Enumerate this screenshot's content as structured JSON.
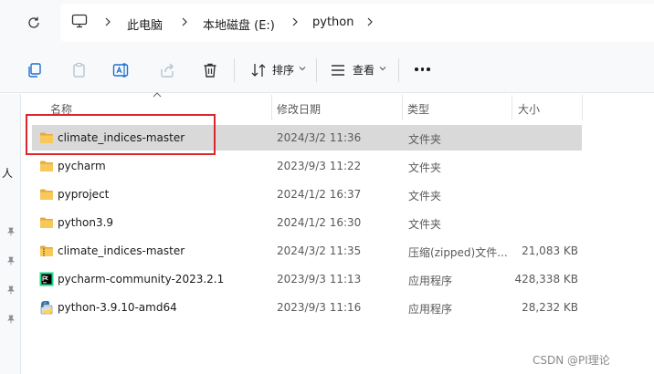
{
  "address_bar": {
    "crumbs": [
      "此电脑",
      "本地磁盘 (E:)",
      "python"
    ]
  },
  "command_bar": {
    "sort_label": "排序",
    "view_label": "查看"
  },
  "nav_pane": {
    "text": "人"
  },
  "columns": {
    "name": "名称",
    "modified": "修改日期",
    "type": "类型",
    "size": "大小"
  },
  "files": [
    {
      "name": "climate_indices-master",
      "modified": "2024/3/2 11:36",
      "type": "文件夹",
      "size": "",
      "icon": "folder-icon",
      "selected": true
    },
    {
      "name": "pycharm",
      "modified": "2023/9/3 11:22",
      "type": "文件夹",
      "size": "",
      "icon": "folder-icon",
      "selected": false
    },
    {
      "name": "pyproject",
      "modified": "2024/1/2 16:37",
      "type": "文件夹",
      "size": "",
      "icon": "folder-icon",
      "selected": false
    },
    {
      "name": "python3.9",
      "modified": "2024/1/2 16:30",
      "type": "文件夹",
      "size": "",
      "icon": "folder-icon",
      "selected": false
    },
    {
      "name": "climate_indices-master",
      "modified": "2024/3/2 11:35",
      "type": "压缩(zipped)文件...",
      "size": "21,083 KB",
      "icon": "zip-folder-icon",
      "selected": false
    },
    {
      "name": "pycharm-community-2023.2.1",
      "modified": "2023/9/3 11:13",
      "type": "应用程序",
      "size": "428,338 KB",
      "icon": "pycharm-app-icon",
      "selected": false
    },
    {
      "name": "python-3.9.10-amd64",
      "modified": "2023/9/3 11:16",
      "type": "应用程序",
      "size": "28,232 KB",
      "icon": "python-installer-icon",
      "selected": false
    }
  ],
  "watermark": "CSDN @PI理论",
  "colors": {
    "selection": "#d9d9d9",
    "highlight_border": "#d9272e",
    "folder": "#f2c14e"
  }
}
